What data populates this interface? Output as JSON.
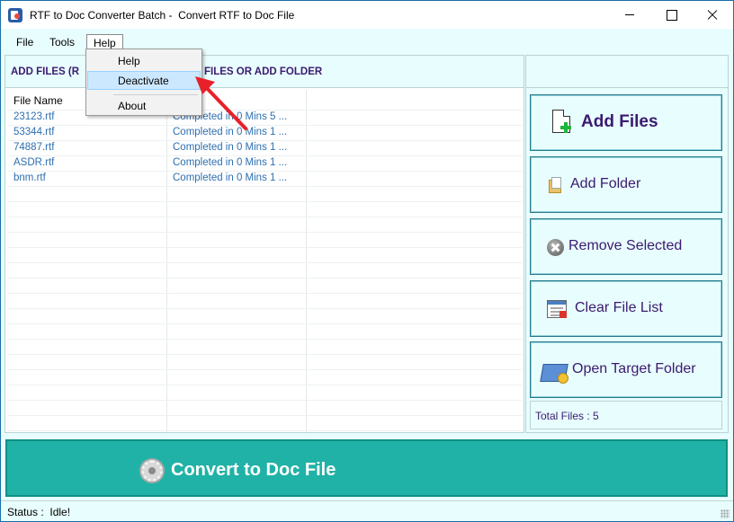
{
  "window": {
    "title": "RTF to Doc Converter Batch -  Convert RTF to Doc File"
  },
  "menu": {
    "file": "File",
    "tools": "Tools",
    "help": "Help"
  },
  "help_menu": {
    "items": [
      "Help",
      "Deactivate",
      "About"
    ],
    "highlighted": "Deactivate"
  },
  "left_panel": {
    "header_visible_prefix": "ADD FILES (R",
    "header_visible_suffix": "FILES OR ADD FOLDER",
    "column_name": "File Name",
    "files": [
      {
        "name": "23123.rtf",
        "status": "Completed in 0 Mins 5 ..."
      },
      {
        "name": "53344.rtf",
        "status": "Completed in 0 Mins 1 ..."
      },
      {
        "name": "74887.rtf",
        "status": "Completed in 0 Mins 1 ..."
      },
      {
        "name": "ASDR.rtf",
        "status": "Completed in 0 Mins 1 ..."
      },
      {
        "name": "bnm.rtf",
        "status": "Completed in 0 Mins 1 ..."
      }
    ]
  },
  "actions": {
    "add_files": "Add Files",
    "add_folder": "Add Folder",
    "remove_selected": "Remove Selected",
    "clear_file_list": "Clear File List",
    "open_target_folder": "Open Target Folder"
  },
  "total_files": "Total Files : 5",
  "convert": {
    "label": "Convert to Doc File"
  },
  "status": {
    "text": "Status :  Idle!"
  },
  "colors": {
    "accent": "#20b2a6",
    "panel_bg": "#e8fdfd",
    "label_purple": "#3b1a70",
    "file_text": "#2d6fb0",
    "annotation_arrow": "#e8202a"
  },
  "icons": {
    "add_files": "add-file-icon",
    "add_folder": "folder-icon",
    "remove_selected": "remove-icon",
    "clear_file_list": "clear-list-icon",
    "open_target_folder": "open-folder-icon",
    "convert": "gear-icon"
  }
}
